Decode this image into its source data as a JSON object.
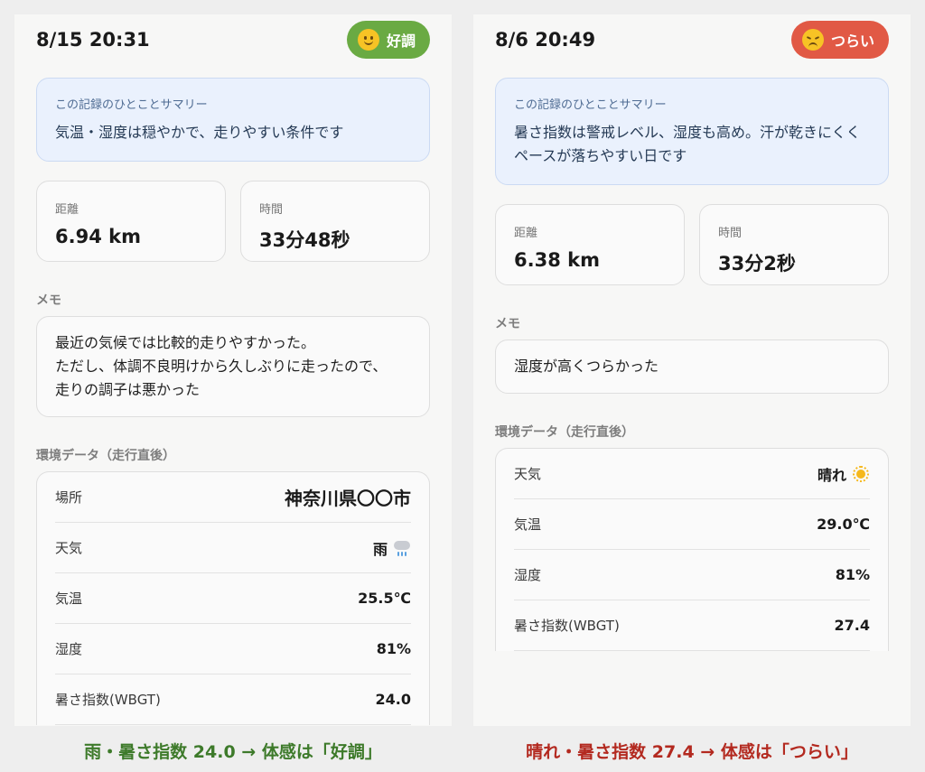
{
  "left": {
    "datetime": "8/15 20:31",
    "mood_label": "好調",
    "mood_icon": "smiling-face-icon",
    "summary_label": "この記録のひとことサマリー",
    "summary_text": "気温・湿度は穏やかで、走りやすい条件です",
    "distance_label": "距離",
    "distance_value": "6.94 km",
    "time_label": "時間",
    "time_value": "33分48秒",
    "memo_label": "メモ",
    "memo_lines": [
      "最近の気候では比較的走りやすかった。",
      "ただし、体調不良明けから久しぶりに走ったので、",
      "走りの調子は悪かった"
    ],
    "env_label": "環境データ（走行直後）",
    "env_rows": [
      {
        "key": "場所",
        "value": "神奈川県〇〇市"
      },
      {
        "key": "天気",
        "value": "雨"
      },
      {
        "key": "気温",
        "value": "25.5℃"
      },
      {
        "key": "湿度",
        "value": "81%"
      },
      {
        "key": "暑さ指数(WBGT)",
        "value": "24.0"
      }
    ],
    "weather_icon": "rain-cloud-icon",
    "caption": "雨・暑さ指数 24.0 → 体感は「好調」",
    "accent": "#6aaa43"
  },
  "right": {
    "datetime": "8/6 20:49",
    "mood_label": "つらい",
    "mood_icon": "frowning-face-icon",
    "summary_label": "この記録のひとことサマリー",
    "summary_text": "暑さ指数は警戒レベル、湿度も高め。汗が乾きにくくペースが落ちやすい日です",
    "distance_label": "距離",
    "distance_value": "6.38 km",
    "time_label": "時間",
    "time_value": "33分2秒",
    "memo_label": "メモ",
    "memo_lines": [
      "湿度が高くつらかった"
    ],
    "env_label": "環境データ（走行直後）",
    "env_rows": [
      {
        "key": "天気",
        "value": "晴れ"
      },
      {
        "key": "気温",
        "value": "29.0℃"
      },
      {
        "key": "湿度",
        "value": "81%"
      },
      {
        "key": "暑さ指数(WBGT)",
        "value": "27.4"
      }
    ],
    "weather_icon": "sun-icon",
    "caption": "晴れ・暑さ指数 27.4 → 体感は「つらい」",
    "accent": "#e15945"
  }
}
